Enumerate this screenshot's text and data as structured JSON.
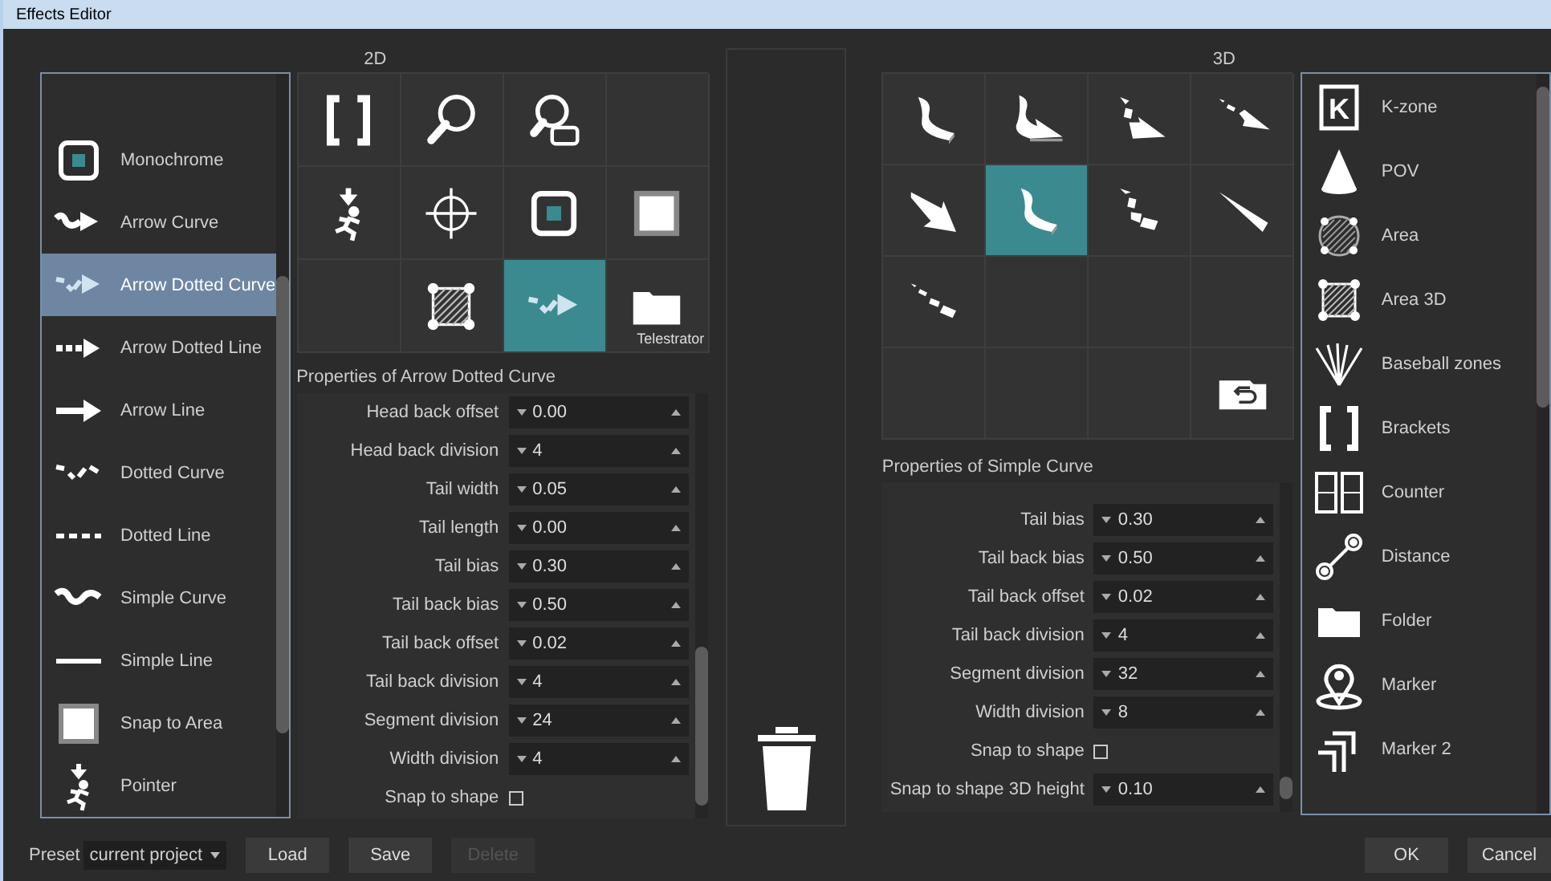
{
  "window": {
    "title": "Effects Editor"
  },
  "list_2d": {
    "items": [
      {
        "label": "Monochrome",
        "kind": "monochrome",
        "selected": false
      },
      {
        "label": "Arrow Curve",
        "kind": "arrowcurve",
        "selected": false
      },
      {
        "label": "Arrow Dotted Curve",
        "kind": "arrowdottedcurve",
        "selected": true
      },
      {
        "label": "Arrow Dotted Line",
        "kind": "arrowdottedline",
        "selected": false
      },
      {
        "label": "Arrow Line",
        "kind": "arrowline",
        "selected": false
      },
      {
        "label": "Dotted Curve",
        "kind": "dottedcurve",
        "selected": false
      },
      {
        "label": "Dotted Line",
        "kind": "dottedline",
        "selected": false
      },
      {
        "label": "Simple Curve",
        "kind": "simplecurve",
        "selected": false
      },
      {
        "label": "Simple Line",
        "kind": "simpleline",
        "selected": false
      },
      {
        "label": "Snap to Area",
        "kind": "snaparea",
        "selected": false
      },
      {
        "label": "Pointer",
        "kind": "pointer",
        "selected": false
      }
    ]
  },
  "panel_2d": {
    "heading": "2D",
    "cells": [
      {
        "kind": "brackets",
        "selected": false
      },
      {
        "kind": "magnifier",
        "selected": false
      },
      {
        "kind": "magnifierframe",
        "selected": false
      },
      {
        "kind": "empty",
        "selected": false
      },
      {
        "kind": "pointer",
        "selected": false
      },
      {
        "kind": "crosshair",
        "selected": false
      },
      {
        "kind": "monochrome",
        "selected": false
      },
      {
        "kind": "snaparea",
        "selected": false
      },
      {
        "kind": "empty",
        "selected": false
      },
      {
        "kind": "hatchedarea",
        "selected": false
      },
      {
        "kind": "arrowdottedcurve",
        "selected": true
      },
      {
        "kind": "folder",
        "selected": false,
        "label": "Telestrator"
      }
    ],
    "properties_title": "Properties of Arrow Dotted Curve",
    "properties": [
      {
        "kind": "spin",
        "label": "Head back offset",
        "value": "0.00"
      },
      {
        "kind": "spin",
        "label": "Head back division",
        "value": "4"
      },
      {
        "kind": "spin",
        "label": "Tail width",
        "value": "0.05"
      },
      {
        "kind": "spin",
        "label": "Tail length",
        "value": "0.00"
      },
      {
        "kind": "spin",
        "label": "Tail bias",
        "value": "0.30"
      },
      {
        "kind": "spin",
        "label": "Tail back bias",
        "value": "0.50"
      },
      {
        "kind": "spin",
        "label": "Tail back offset",
        "value": "0.02"
      },
      {
        "kind": "spin",
        "label": "Tail back division",
        "value": "4"
      },
      {
        "kind": "spin",
        "label": "Segment division",
        "value": "24"
      },
      {
        "kind": "spin",
        "label": "Width division",
        "value": "4"
      },
      {
        "kind": "check",
        "label": "Snap to shape",
        "checked": false
      }
    ]
  },
  "panel_3d": {
    "heading": "3D",
    "cells": [
      {
        "kind": "curve3d",
        "selected": false
      },
      {
        "kind": "curvearrow3d",
        "selected": false
      },
      {
        "kind": "dottedcurvearrow3d",
        "selected": false
      },
      {
        "kind": "dottedarrow3d",
        "selected": false
      },
      {
        "kind": "arrow3d",
        "selected": false
      },
      {
        "kind": "curve3d",
        "selected": true
      },
      {
        "kind": "dottedcurve3d",
        "selected": false
      },
      {
        "kind": "wedge3d",
        "selected": false
      },
      {
        "kind": "dottedline3d",
        "selected": false
      },
      {
        "kind": "empty",
        "selected": false
      },
      {
        "kind": "empty",
        "selected": false
      },
      {
        "kind": "empty",
        "selected": false
      },
      {
        "kind": "empty",
        "selected": false
      },
      {
        "kind": "empty",
        "selected": false
      },
      {
        "kind": "empty",
        "selected": false
      },
      {
        "kind": "backfolder",
        "selected": false
      }
    ],
    "properties_title": "Properties of Simple Curve",
    "properties": [
      {
        "kind": "spin",
        "label": "Tail bias",
        "value": "0.30"
      },
      {
        "kind": "spin",
        "label": "Tail back bias",
        "value": "0.50"
      },
      {
        "kind": "spin",
        "label": "Tail back offset",
        "value": "0.02"
      },
      {
        "kind": "spin",
        "label": "Tail back division",
        "value": "4"
      },
      {
        "kind": "spin",
        "label": "Segment division",
        "value": "32"
      },
      {
        "kind": "spin",
        "label": "Width division",
        "value": "8"
      },
      {
        "kind": "check",
        "label": "Snap to shape",
        "checked": false
      },
      {
        "kind": "spin",
        "label": "Snap to shape 3D height",
        "value": "0.10"
      }
    ]
  },
  "list_3d": {
    "items": [
      {
        "label": "K-zone",
        "kind": "kzone",
        "badge": "K",
        "selected": false
      },
      {
        "label": "POV",
        "kind": "cone",
        "selected": false
      },
      {
        "label": "Area",
        "kind": "hatchedcircle",
        "selected": false
      },
      {
        "label": "Area 3D",
        "kind": "hatchedarea",
        "selected": false
      },
      {
        "label": "Baseball zones",
        "kind": "fan",
        "selected": false
      },
      {
        "label": "Brackets",
        "kind": "brackets",
        "selected": false
      },
      {
        "label": "Counter",
        "kind": "counter",
        "selected": false
      },
      {
        "label": "Distance",
        "kind": "distance",
        "selected": false
      },
      {
        "label": "Folder",
        "kind": "folder",
        "selected": false
      },
      {
        "label": "Marker",
        "kind": "marker",
        "selected": false
      },
      {
        "label": "Marker 2",
        "kind": "marker2",
        "selected": false
      }
    ]
  },
  "footer": {
    "preset_label": "Preset",
    "preset_value": "current project",
    "buttons": [
      {
        "label": "Load",
        "disabled": false
      },
      {
        "label": "Save",
        "disabled": false
      },
      {
        "label": "Delete",
        "disabled": true
      }
    ],
    "dialog_buttons": [
      {
        "label": "OK",
        "disabled": false
      },
      {
        "label": "Cancel",
        "disabled": false
      }
    ]
  }
}
